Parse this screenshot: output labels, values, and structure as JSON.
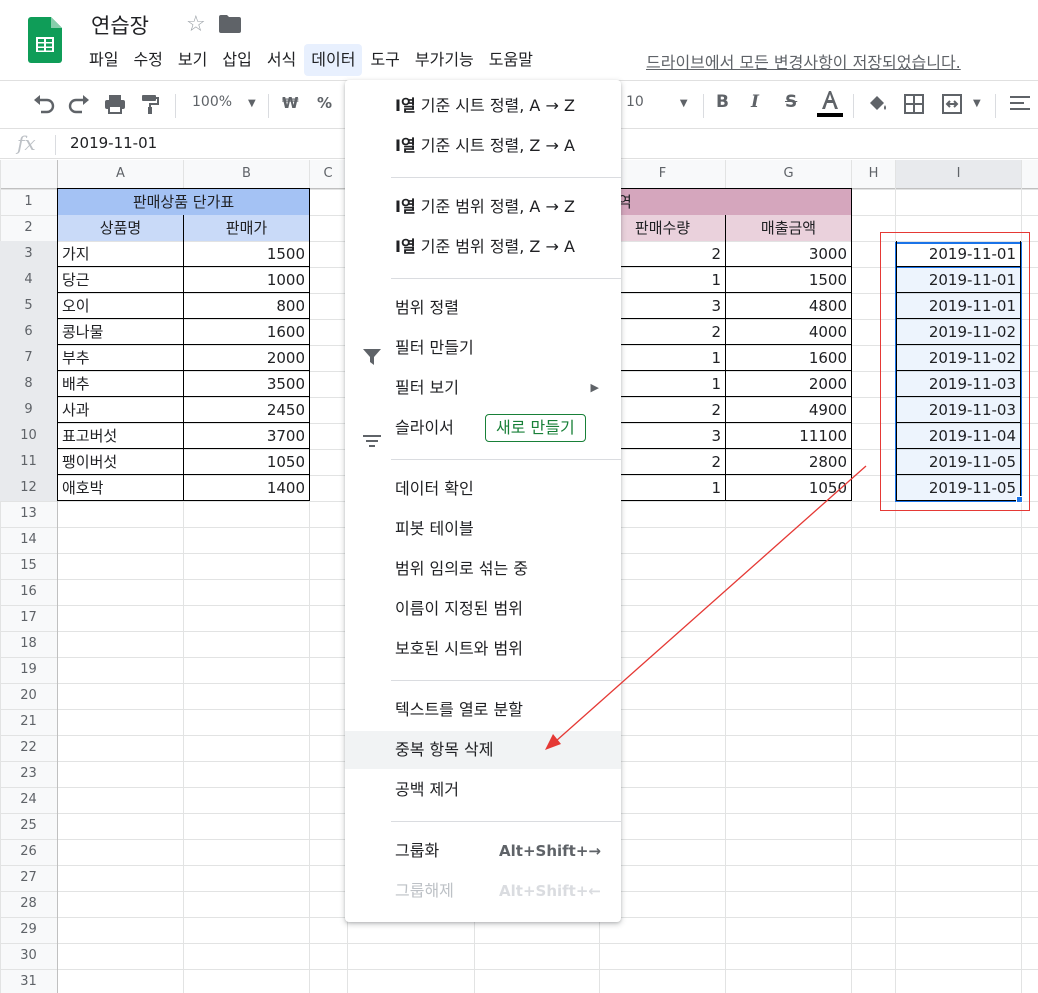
{
  "doc": {
    "title": "연습장",
    "save_status": "드라이브에서 모든 변경사항이 저장되었습니다."
  },
  "menubar": [
    "파일",
    "수정",
    "보기",
    "삽입",
    "서식",
    "데이터",
    "도구",
    "부가기능",
    "도움말"
  ],
  "toolbar": {
    "zoom": "100%",
    "currency": "₩",
    "percent": "%",
    "font_size": "10"
  },
  "formula_bar": {
    "fx": "fx",
    "value": "2019-11-01"
  },
  "columns": [
    "A",
    "B",
    "C",
    "F",
    "G",
    "H",
    "I"
  ],
  "rows": [
    "1",
    "2",
    "3",
    "4",
    "5",
    "6",
    "7",
    "8",
    "9",
    "10",
    "11",
    "12",
    "13",
    "14",
    "15",
    "16",
    "17",
    "18",
    "19",
    "20",
    "21",
    "22",
    "23",
    "24",
    "25",
    "26",
    "27",
    "28",
    "29",
    "30",
    "31"
  ],
  "price_table": {
    "title": "판매상품 단가표",
    "headers": [
      "상품명",
      "판매가"
    ],
    "rows": [
      [
        "가지",
        "1500"
      ],
      [
        "당근",
        "1000"
      ],
      [
        "오이",
        "800"
      ],
      [
        "콩나물",
        "1600"
      ],
      [
        "부추",
        "2000"
      ],
      [
        "배추",
        "3500"
      ],
      [
        "사과",
        "2450"
      ],
      [
        "표고버섯",
        "3700"
      ],
      [
        "팽이버섯",
        "1050"
      ],
      [
        "애호박",
        "1400"
      ]
    ]
  },
  "sales_table": {
    "title_fragment": "역",
    "headers": [
      "판매수량",
      "매출금액"
    ],
    "rows": [
      [
        "2",
        "3000"
      ],
      [
        "1",
        "1500"
      ],
      [
        "3",
        "4800"
      ],
      [
        "2",
        "4000"
      ],
      [
        "1",
        "1600"
      ],
      [
        "1",
        "2000"
      ],
      [
        "2",
        "4900"
      ],
      [
        "3",
        "11100"
      ],
      [
        "2",
        "2800"
      ],
      [
        "1",
        "1050"
      ]
    ]
  },
  "dates": [
    "2019-11-01",
    "2019-11-01",
    "2019-11-01",
    "2019-11-02",
    "2019-11-02",
    "2019-11-03",
    "2019-11-03",
    "2019-11-04",
    "2019-11-05",
    "2019-11-05"
  ],
  "data_menu": {
    "sort_sheet_az_prefix": "I열",
    "sort_sheet_az": " 기준 시트 정렬, A → Z",
    "sort_sheet_za_prefix": "I열",
    "sort_sheet_za": " 기준 시트 정렬, Z → A",
    "sort_range_az_prefix": "I열",
    "sort_range_az": " 기준 범위 정렬, A → Z",
    "sort_range_za_prefix": "I열",
    "sort_range_za": " 기준 범위 정렬, Z → A",
    "sort_range": "범위 정렬",
    "create_filter": "필터 만들기",
    "filter_views": "필터 보기",
    "slicer": "슬라이서",
    "slicer_new": "새로 만들기",
    "data_validation": "데이터 확인",
    "pivot_table": "피봇 테이블",
    "randomize_range": "범위 임의로 섞는 중",
    "named_ranges": "이름이 지정된 범위",
    "protected": "보호된 시트와 범위",
    "split_text": "텍스트를 열로 분할",
    "remove_duplicates": "중복 항목 삭제",
    "trim_whitespace": "공백 제거",
    "group": "그룹화",
    "group_shortcut": "Alt+Shift+→",
    "ungroup": "그룹해제",
    "ungroup_shortcut": "Alt+Shift+←"
  },
  "colors": {
    "header_blue": "#a4c2f4",
    "subheader_blue": "#c9daf8",
    "header_pink": "#d5a6bd",
    "subheader_pink": "#ead1dc",
    "selection": "#1a73e8",
    "annotation_red": "#e53935",
    "sheets_green": "#0f9d58"
  }
}
